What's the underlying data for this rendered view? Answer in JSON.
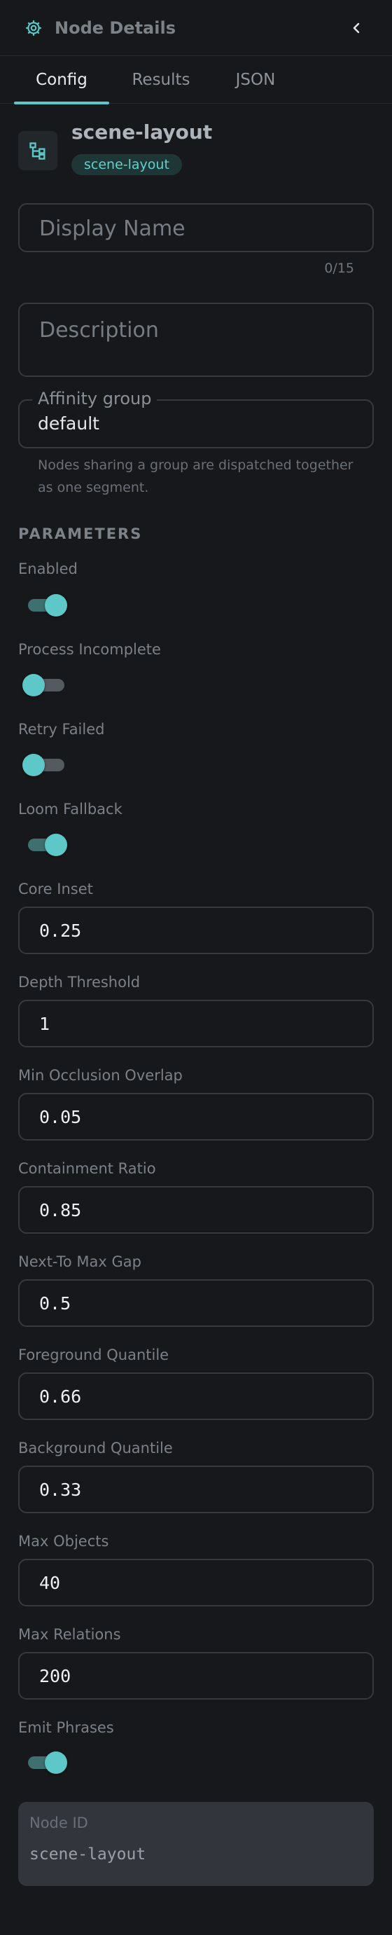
{
  "header": {
    "title": "Node Details",
    "icon": "gear-icon",
    "back_icon": "chevron-left-icon"
  },
  "tabs": [
    {
      "label": "Config",
      "active": true
    },
    {
      "label": "Results",
      "active": false
    },
    {
      "label": "JSON",
      "active": false
    }
  ],
  "node": {
    "icon": "hierarchy-icon",
    "title": "scene-layout",
    "type_badge": "scene-layout"
  },
  "display_name": {
    "placeholder": "Display Name",
    "value": "",
    "counter": "0/15"
  },
  "description": {
    "placeholder": "Description",
    "value": ""
  },
  "affinity": {
    "label": "Affinity group",
    "value": "default",
    "help": "Nodes sharing a group are dispatched together as one segment."
  },
  "parameters": {
    "section_label": "PARAMETERS",
    "enabled": {
      "label": "Enabled",
      "on": true
    },
    "process_incomplete": {
      "label": "Process Incomplete",
      "on": false
    },
    "retry_failed": {
      "label": "Retry Failed",
      "on": false
    },
    "loom_fallback": {
      "label": "Loom Fallback",
      "on": true
    },
    "core_inset": {
      "label": "Core Inset",
      "value": "0.25"
    },
    "depth_threshold": {
      "label": "Depth Threshold",
      "value": "1"
    },
    "min_occlusion_overlap": {
      "label": "Min Occlusion Overlap",
      "value": "0.05"
    },
    "containment_ratio": {
      "label": "Containment Ratio",
      "value": "0.85"
    },
    "next_to_max_gap": {
      "label": "Next-To Max Gap",
      "value": "0.5"
    },
    "foreground_quantile": {
      "label": "Foreground Quantile",
      "value": "0.66"
    },
    "background_quantile": {
      "label": "Background Quantile",
      "value": "0.33"
    },
    "max_objects": {
      "label": "Max Objects",
      "value": "40"
    },
    "max_relations": {
      "label": "Max Relations",
      "value": "200"
    },
    "emit_phrases": {
      "label": "Emit Phrases",
      "on": true
    }
  },
  "node_id": {
    "label": "Node ID",
    "value": "scene-layout"
  },
  "colors": {
    "accent": "#5ec7c7",
    "background": "#16181b",
    "badge_bg": "#1f3636"
  }
}
